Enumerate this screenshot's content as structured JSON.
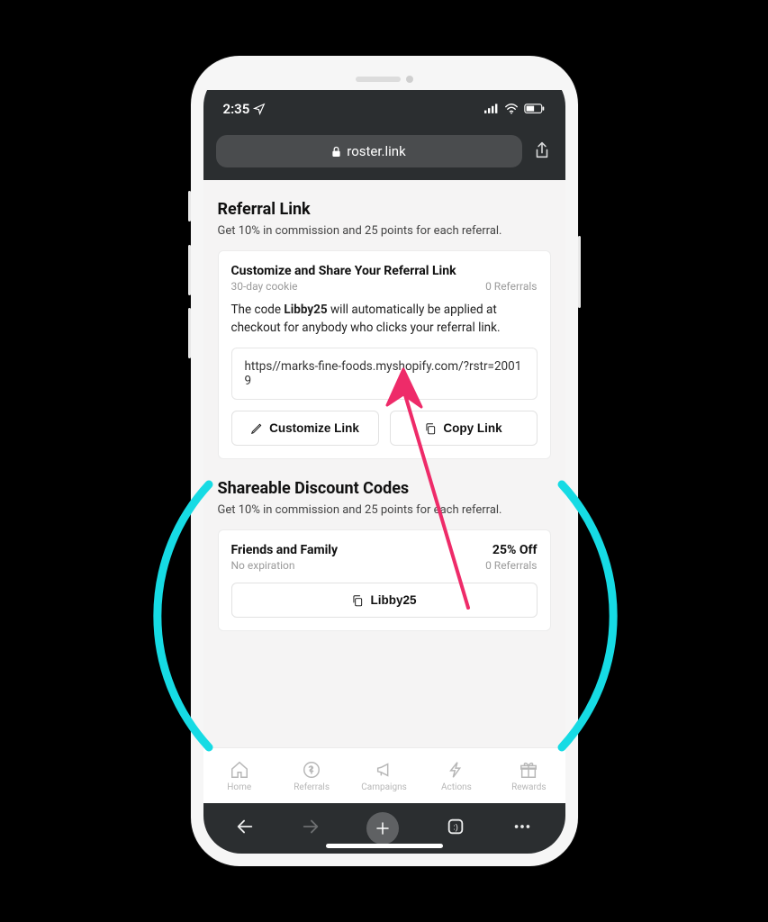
{
  "status": {
    "time": "2:35",
    "location_icon": "location-arrow",
    "wifi_icon": "wifi",
    "battery_icon": "battery"
  },
  "browser": {
    "lock_icon": "lock",
    "domain": "roster.link",
    "share_icon": "share"
  },
  "referral": {
    "heading": "Referral Link",
    "subtitle": "Get 10% in commission and 25 points for each referral.",
    "card": {
      "title": "Customize and Share Your Referral Link",
      "cookie": "30-day cookie",
      "referrals": "0 Referrals",
      "desc_prefix": "The code ",
      "desc_code": "Libby25",
      "desc_suffix": " will automatically be applied at checkout for anybody who clicks your referral link.",
      "url": "https//marks-fine-foods.myshopify.com/?rstr=20019",
      "customize_label": "Customize Link",
      "copy_label": "Copy Link"
    }
  },
  "discounts": {
    "heading": "Shareable Discount Codes",
    "subtitle": "Get 10% in commission and 25 points for each referral.",
    "card": {
      "name": "Friends and Family",
      "off": "25% Off",
      "expiry": "No expiration",
      "referrals": "0 Referrals",
      "code_label": "Libby25"
    }
  },
  "tabs": [
    {
      "label": "Home"
    },
    {
      "label": "Referrals"
    },
    {
      "label": "Campaigns"
    },
    {
      "label": "Actions"
    },
    {
      "label": "Rewards"
    }
  ],
  "colors": {
    "highlight": "#16dbe4",
    "arrow": "#ee2b69",
    "chrome": "#2b2e30"
  }
}
